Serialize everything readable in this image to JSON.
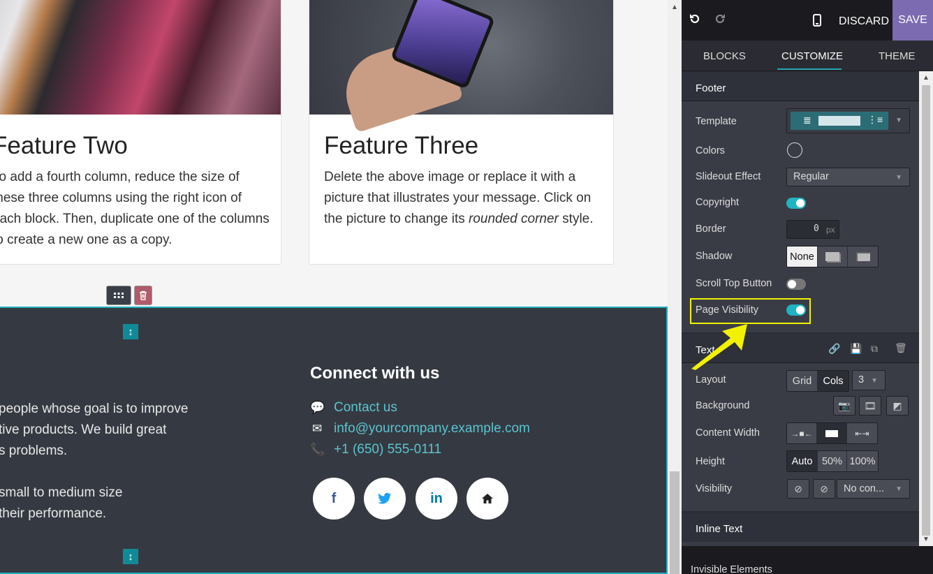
{
  "canvas": {
    "card2": {
      "title": "Feature Two",
      "text": "To add a fourth column, reduce the size of these three columns using the right icon of each block. Then, duplicate one of the columns to create a new one as a copy."
    },
    "card3": {
      "title": "Feature Three",
      "text_before": "Delete the above image or replace it with a picture that illustrates your message. Click on the picture to change its ",
      "text_em": "rounded corner",
      "text_after": " style."
    },
    "footer": {
      "lead_lines": [
        "people whose goal is to improve",
        "tive products. We build great",
        "s problems.",
        "",
        "small to medium size",
        "their performance."
      ],
      "connect_title": "Connect with us",
      "contacts": [
        {
          "icon": "comment-icon",
          "text": "Contact us"
        },
        {
          "icon": "envelope-icon",
          "text": "info@yourcompany.example.com"
        },
        {
          "icon": "phone-icon",
          "text": "+1 (650) 555-0111"
        }
      ],
      "socials": [
        {
          "name": "facebook-icon",
          "glyph": "f",
          "color": "#3b5998"
        },
        {
          "name": "twitter-icon",
          "glyph": "🐦",
          "color": "#1da1f2"
        },
        {
          "name": "linkedin-icon",
          "glyph": "in",
          "color": "#0077b5"
        },
        {
          "name": "home-icon",
          "glyph": "⌂",
          "color": "#222222"
        }
      ]
    }
  },
  "panel": {
    "topbar": {
      "discard": "DISCARD",
      "save": "SAVE",
      "accent": "#7c6bb0"
    },
    "tabs": [
      "BLOCKS",
      "CUSTOMIZE",
      "THEME"
    ],
    "active_tab": "CUSTOMIZE",
    "footer_section": {
      "title": "Footer",
      "template_label": "Template",
      "colors_label": "Colors",
      "slideout_label": "Slideout Effect",
      "slideout_value": "Regular",
      "copyright_label": "Copyright",
      "copyright_on": true,
      "border_label": "Border",
      "border_value": "0",
      "border_unit": "px",
      "shadow_label": "Shadow",
      "shadow_none": "None",
      "scroll_top_label": "Scroll Top Button",
      "scroll_top_on": false,
      "page_visibility_label": "Page Visibility",
      "page_visibility_on": true
    },
    "text_section": {
      "title": "Text",
      "layout_label": "Layout",
      "layout_grid": "Grid",
      "layout_cols": "Cols",
      "layout_cols_value": "3",
      "background_label": "Background",
      "content_width_label": "Content Width",
      "height_label": "Height",
      "height_auto": "Auto",
      "height_50": "50%",
      "height_100": "100%",
      "visibility_label": "Visibility",
      "visibility_value": "No con..."
    },
    "inline_text_title": "Inline Text",
    "invisible_elements": "Invisible Elements",
    "toggle_color": "#1fb4c2",
    "highlight_color": "#f2f200"
  }
}
